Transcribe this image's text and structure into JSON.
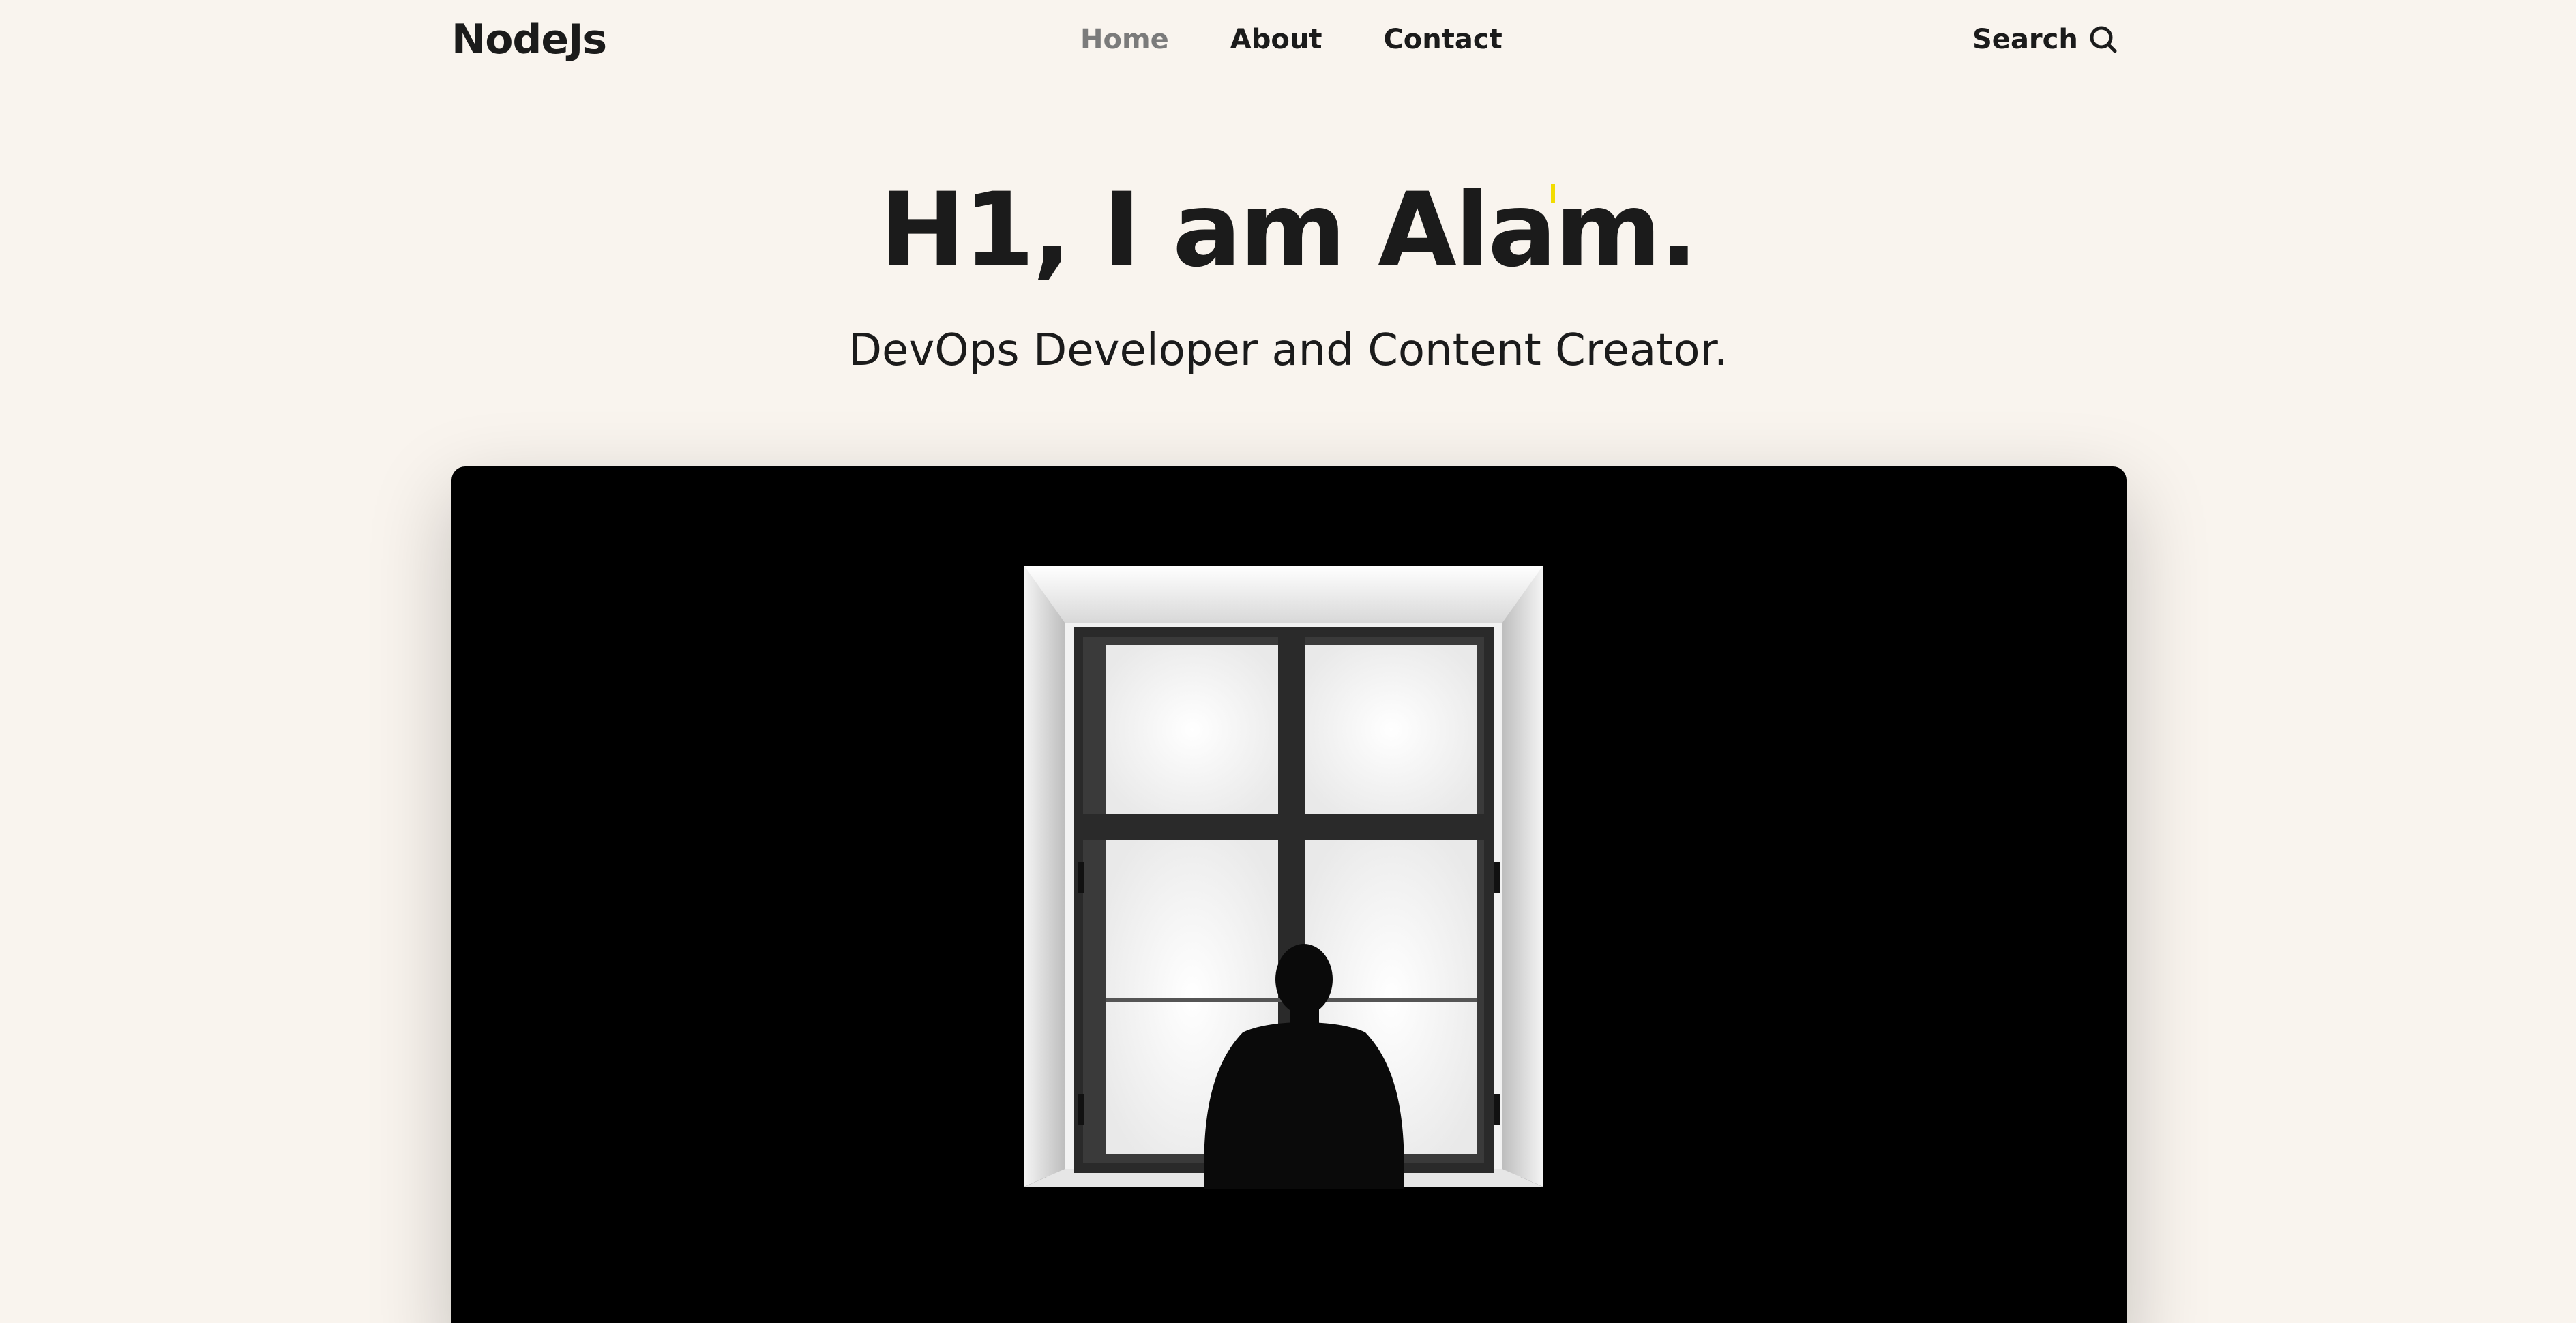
{
  "header": {
    "logo": "NodeJs",
    "nav": [
      {
        "label": "Home",
        "active": true
      },
      {
        "label": "About",
        "active": false
      },
      {
        "label": "Contact",
        "active": false
      }
    ],
    "search_label": "Search",
    "search_icon": "search-icon"
  },
  "hero": {
    "title": "H1, I am Alam.",
    "subtitle": "DevOps Developer and Content Creator."
  },
  "feature_image": {
    "description_icon": "person-at-window-photo"
  },
  "colors": {
    "background": "#f9f4ee",
    "text": "#1b1b1b",
    "nav_active": "#7b7b7b",
    "cursor_accent": "#f2dc00"
  }
}
